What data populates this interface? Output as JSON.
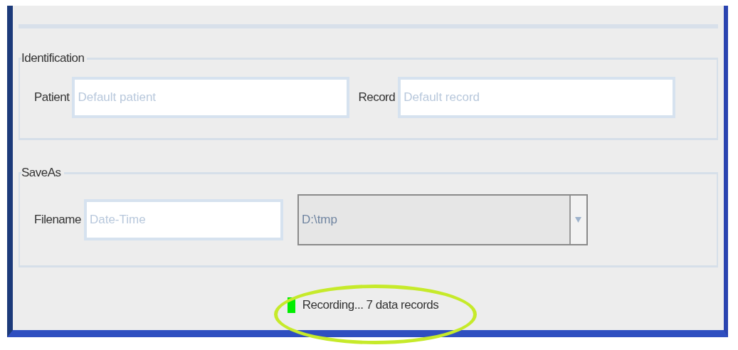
{
  "sections": [
    {
      "legend": "Identification",
      "fields": [
        {
          "kind": "text",
          "label": "Patient",
          "placeholder": "Default patient"
        },
        {
          "kind": "text",
          "label": "Record",
          "placeholder": "Default record"
        }
      ]
    },
    {
      "legend": "SaveAs",
      "fields": [
        {
          "kind": "text",
          "label": "Filename",
          "placeholder": "Date-Time"
        },
        {
          "kind": "combo",
          "value": "D:\\tmp",
          "disabled": true
        }
      ]
    }
  ],
  "status": {
    "recording": true,
    "text": "Recording... 7 data records"
  }
}
